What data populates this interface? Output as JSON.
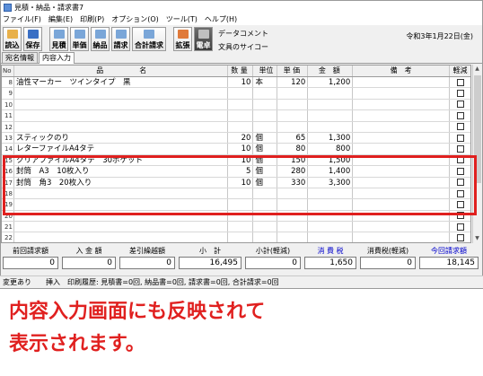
{
  "window": {
    "title": "見積・納品・請求書7"
  },
  "menu": [
    "ファイル(F)",
    "編集(E)",
    "印刷(P)",
    "オプション(O)",
    "ツール(T)",
    "ヘルプ(H)"
  ],
  "toolbar": {
    "buttons": [
      {
        "label": "読込",
        "color": "#e8b04a"
      },
      {
        "label": "保存",
        "color": "#3a6fc4"
      },
      {
        "label": "見積",
        "color": "#7aa6d8"
      },
      {
        "label": "単価",
        "color": "#7aa6d8"
      },
      {
        "label": "納品",
        "color": "#7aa6d8"
      },
      {
        "label": "請求",
        "color": "#7aa6d8"
      },
      {
        "label": "合計請求",
        "color": "#7aa6d8"
      },
      {
        "label": "拡張",
        "color": "#e07a3a"
      },
      {
        "label": "電卓",
        "color": "#bfbfbf"
      }
    ],
    "data_comment_label": "データコメント",
    "data_comment_value": "文具のサイコー",
    "date": "令和3年1月22日(金)"
  },
  "tabs": [
    {
      "label": "宛名情報",
      "active": false
    },
    {
      "label": "内容入力",
      "active": true
    }
  ],
  "grid": {
    "headers": {
      "no": "No",
      "name": "品　　　　　名",
      "qty": "数 量",
      "unit": "単位",
      "price": "単 価",
      "amount": "金　額",
      "note": "備　考",
      "tax": "軽減"
    },
    "rows": [
      {
        "no": "8",
        "name": "油性マーカー　ツインタイプ　黒",
        "qty": "10",
        "unit": "本",
        "price": "120",
        "amount": "1,200"
      },
      {
        "no": "9",
        "name": "",
        "qty": "",
        "unit": "",
        "price": "",
        "amount": ""
      },
      {
        "no": "10",
        "name": "",
        "qty": "",
        "unit": "",
        "price": "",
        "amount": ""
      },
      {
        "no": "11",
        "name": "",
        "qty": "",
        "unit": "",
        "price": "",
        "amount": ""
      },
      {
        "no": "12",
        "name": "",
        "qty": "",
        "unit": "",
        "price": "",
        "amount": ""
      },
      {
        "no": "13",
        "name": "スティックのり",
        "qty": "20",
        "unit": "個",
        "price": "65",
        "amount": "1,300"
      },
      {
        "no": "14",
        "name": "レターファイルA4タテ",
        "qty": "10",
        "unit": "個",
        "price": "80",
        "amount": "800"
      },
      {
        "no": "15",
        "name": "クリアファイルA4タテ　30ポケット",
        "qty": "10",
        "unit": "個",
        "price": "150",
        "amount": "1,500"
      },
      {
        "no": "16",
        "name": "封筒　A3　10枚入り",
        "qty": "5",
        "unit": "個",
        "price": "280",
        "amount": "1,400"
      },
      {
        "no": "17",
        "name": "封筒　角3　20枚入り",
        "qty": "10",
        "unit": "個",
        "price": "330",
        "amount": "3,300"
      },
      {
        "no": "18",
        "name": "",
        "qty": "",
        "unit": "",
        "price": "",
        "amount": ""
      },
      {
        "no": "19",
        "name": "",
        "qty": "",
        "unit": "",
        "price": "",
        "amount": ""
      },
      {
        "no": "20",
        "name": "",
        "qty": "",
        "unit": "",
        "price": "",
        "amount": ""
      },
      {
        "no": "21",
        "name": "",
        "qty": "",
        "unit": "",
        "price": "",
        "amount": ""
      },
      {
        "no": "22",
        "name": "",
        "qty": "",
        "unit": "",
        "price": "",
        "amount": ""
      }
    ]
  },
  "summary": {
    "prev_invoice": {
      "label": "前回請求額",
      "value": "0"
    },
    "payment": {
      "label": "入 金 額",
      "value": "0"
    },
    "carry_over": {
      "label": "差引繰越額",
      "value": "0"
    },
    "subtotal": {
      "label": "小　計",
      "value": "16,495"
    },
    "subtotal_reduced": {
      "label": "小計(軽減)",
      "value": "0"
    },
    "tax": {
      "label": "消 費 税",
      "value": "1,650"
    },
    "tax_reduced": {
      "label": "消費税(軽減)",
      "value": "0"
    },
    "current_invoice": {
      "label": "今回請求額",
      "value": "18,145"
    },
    "accent_blue": "#0000cc"
  },
  "status_bar": "変更あり　　挿入　印刷履歴: 見積書=0回, 納品書=0回, 請求書=0回, 合計請求=0回",
  "caption": {
    "line1": "内容入力画面にも反映されて",
    "line2": "表示されます。",
    "color": "#e0201f"
  }
}
